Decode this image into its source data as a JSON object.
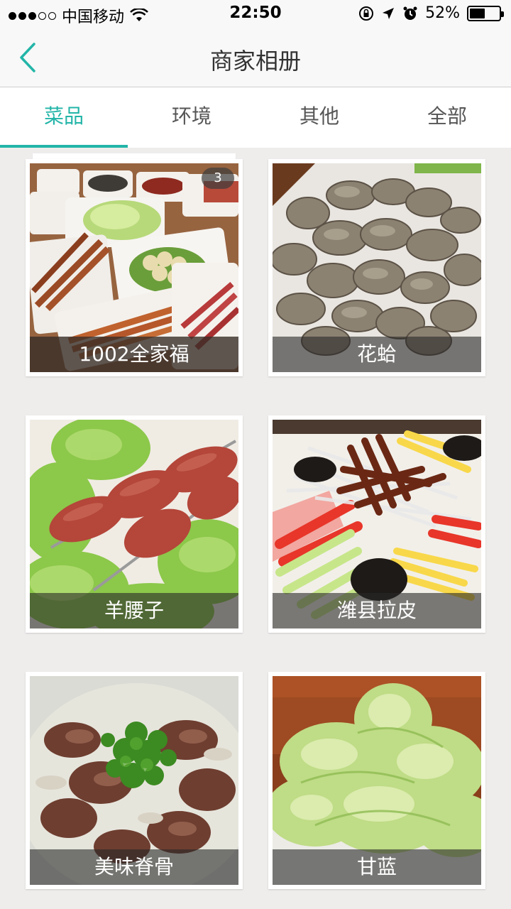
{
  "status_bar": {
    "carrier": "中国移动",
    "time": "22:50",
    "battery_percent": "52%",
    "battery_level": 0.52
  },
  "nav": {
    "title": "商家相册"
  },
  "tabs": [
    {
      "label": "菜品",
      "active": true
    },
    {
      "label": "环境",
      "active": false
    },
    {
      "label": "其他",
      "active": false
    },
    {
      "label": "全部",
      "active": false
    }
  ],
  "album": [
    {
      "caption": "1002全家福",
      "count": "3"
    },
    {
      "caption": "花蛤"
    },
    {
      "caption": "羊腰子"
    },
    {
      "caption": "潍县拉皮"
    },
    {
      "caption": "美味脊骨"
    },
    {
      "caption": "甘蓝"
    }
  ],
  "colors": {
    "accent": "#23b5a8",
    "background": "#efedec"
  }
}
